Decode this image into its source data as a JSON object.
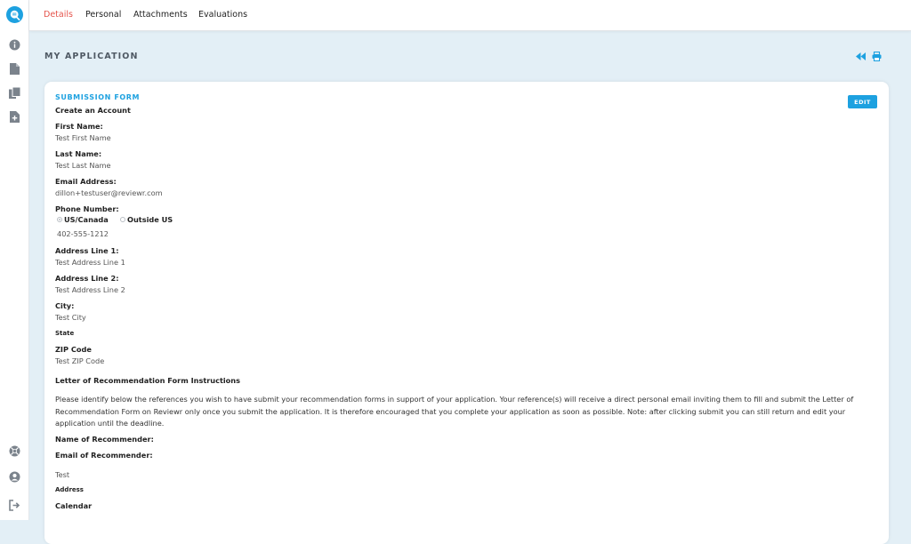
{
  "tabs": [
    {
      "label": "Details",
      "active": true
    },
    {
      "label": "Personal",
      "active": false
    },
    {
      "label": "Attachments",
      "active": false
    },
    {
      "label": "Evaluations",
      "active": false
    }
  ],
  "page": {
    "title": "MY APPLICATION"
  },
  "sidebar_icons": [
    "info-icon",
    "document-icon",
    "documents-icon",
    "add-document-icon",
    "support-icon",
    "user-icon",
    "logout-icon"
  ],
  "colors": {
    "accent": "#1da1e0",
    "active_tab": "#e5534b",
    "background": "#e3eff6"
  },
  "form": {
    "section_title": "SUBMISSION FORM",
    "edit_label": "EDIT",
    "create_account": "Create an Account",
    "first_name_label": "First Name:",
    "first_name_value": "Test First Name",
    "last_name_label": "Last Name:",
    "last_name_value": "Test Last Name",
    "email_label": "Email Address:",
    "email_value": "dillon+testuser@reviewr.com",
    "phone_label": "Phone Number:",
    "phone_option_us": "US/Canada",
    "phone_option_outside": "Outside US",
    "phone_value": "402-555-1212",
    "address1_label": "Address Line 1:",
    "address1_value": "Test Address Line 1",
    "address2_label": "Address Line 2:",
    "address2_value": "Test Address Line 2",
    "city_label": "City:",
    "city_value": "Test City",
    "state_label": "State",
    "zip_label": "ZIP Code",
    "zip_value": "Test ZIP Code",
    "lor_heading": "Letter of Recommendation Form Instructions",
    "lor_text": "Please identify below the references you wish to have submit your recommendation forms in support of your application. Your reference(s) will receive a direct personal email inviting them to fill and submit the Letter of Recommendation Form on Reviewr only once you submit the application. It is therefore encouraged that you complete your application as soon as possible. Note: after clicking submit you can still return and edit your application until the deadline.",
    "recommender_name_label": "Name of Recommender:",
    "recommender_email_label": "Email of Recommender:",
    "test_value": "Test",
    "address_label": "Address",
    "calendar_label": "Calendar"
  }
}
